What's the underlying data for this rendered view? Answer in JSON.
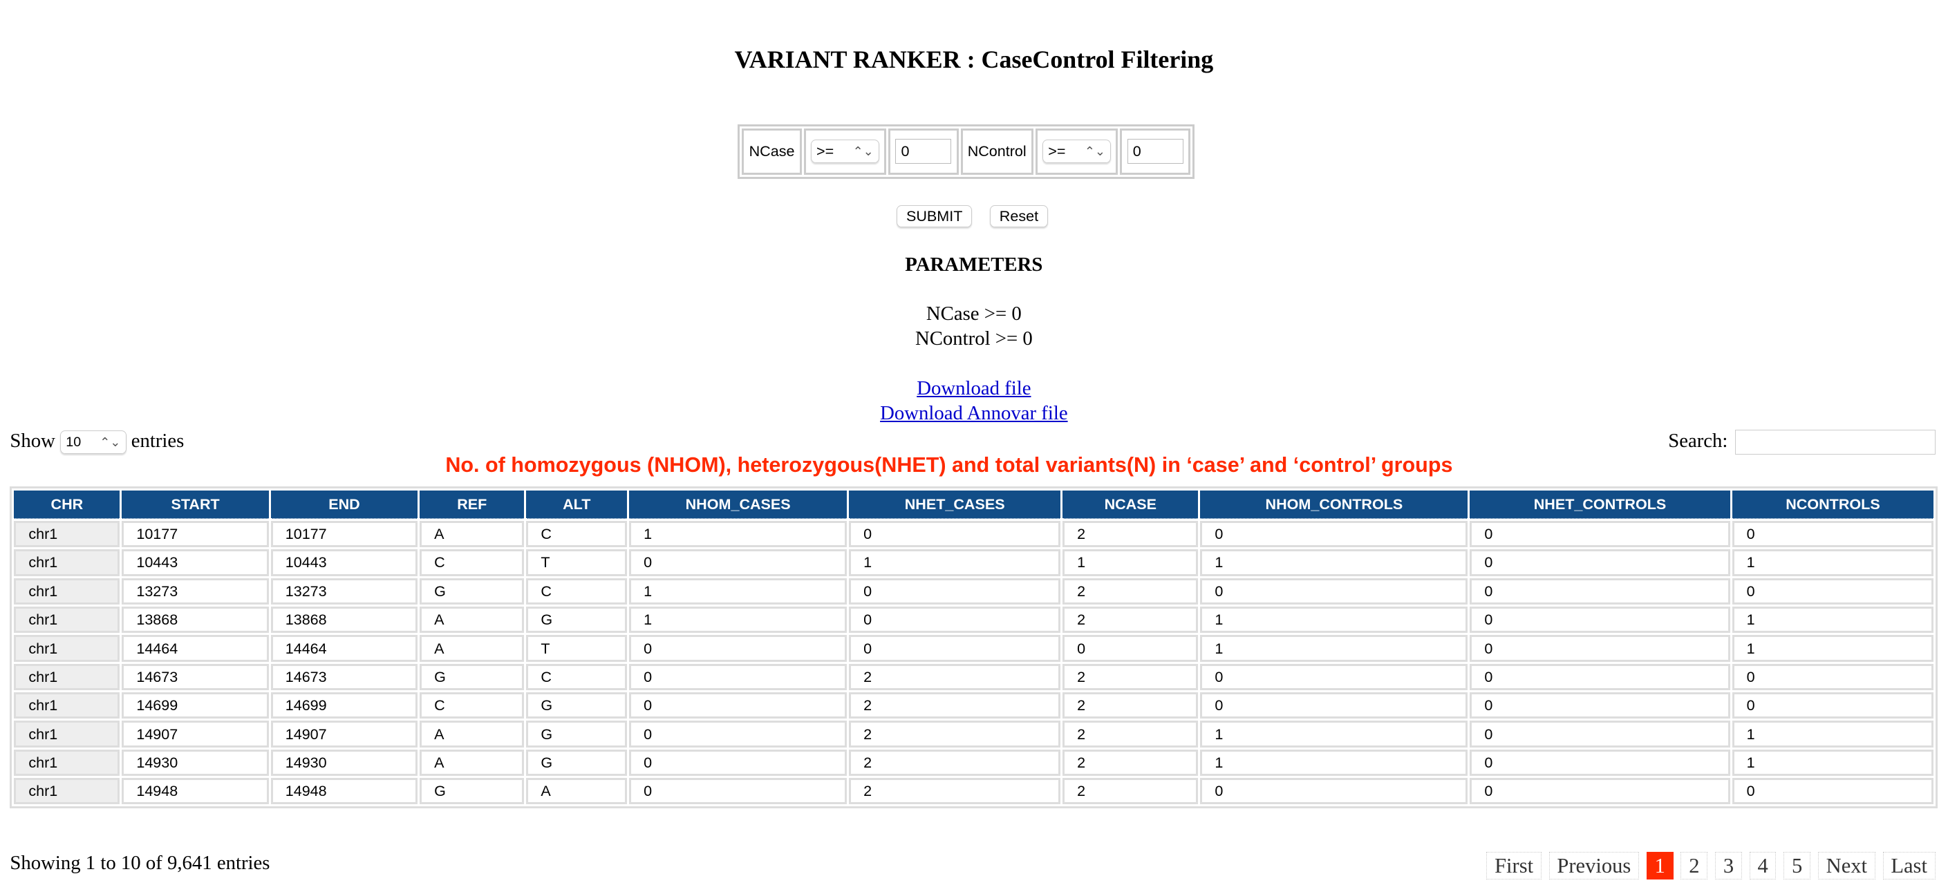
{
  "title": "VARIANT RANKER : CaseControl Filtering",
  "filter": {
    "ncase_label": "NCase",
    "ncase_op": ">=",
    "ncase_value": "0",
    "ncontrol_label": "NControl",
    "ncontrol_op": ">=",
    "ncontrol_value": "0"
  },
  "buttons": {
    "submit": "SUBMIT",
    "reset": "Reset"
  },
  "parameters": {
    "heading": "PARAMETERS",
    "line1": "NCase >= 0",
    "line2": "NControl >= 0"
  },
  "links": {
    "download": "Download file ",
    "annovar": "Download Annovar file"
  },
  "length": {
    "show": "Show",
    "value": "10",
    "entries": "entries"
  },
  "search": {
    "label": "Search:",
    "value": ""
  },
  "caption": "No. of homozygous (NHOM), heterozygous(NHET) and total variants(N) in ‘case’ and ‘control’ groups",
  "columns": [
    "CHR",
    "START",
    "END",
    "REF",
    "ALT",
    "NHOM_CASES",
    "NHET_CASES",
    "NCASE",
    "NHOM_CONTROLS",
    "NHET_CONTROLS",
    "NCONTROLS"
  ],
  "rows": [
    [
      "chr1",
      "10177",
      "10177",
      "A",
      "C",
      "1",
      "0",
      "2",
      "0",
      "0",
      "0"
    ],
    [
      "chr1",
      "10443",
      "10443",
      "C",
      "T",
      "0",
      "1",
      "1",
      "1",
      "0",
      "1"
    ],
    [
      "chr1",
      "13273",
      "13273",
      "G",
      "C",
      "1",
      "0",
      "2",
      "0",
      "0",
      "0"
    ],
    [
      "chr1",
      "13868",
      "13868",
      "A",
      "G",
      "1",
      "0",
      "2",
      "1",
      "0",
      "1"
    ],
    [
      "chr1",
      "14464",
      "14464",
      "A",
      "T",
      "0",
      "0",
      "0",
      "1",
      "0",
      "1"
    ],
    [
      "chr1",
      "14673",
      "14673",
      "G",
      "C",
      "0",
      "2",
      "2",
      "0",
      "0",
      "0"
    ],
    [
      "chr1",
      "14699",
      "14699",
      "C",
      "G",
      "0",
      "2",
      "2",
      "0",
      "0",
      "0"
    ],
    [
      "chr1",
      "14907",
      "14907",
      "A",
      "G",
      "0",
      "2",
      "2",
      "1",
      "0",
      "1"
    ],
    [
      "chr1",
      "14930",
      "14930",
      "A",
      "G",
      "0",
      "2",
      "2",
      "1",
      "0",
      "1"
    ],
    [
      "chr1",
      "14948",
      "14948",
      "G",
      "A",
      "0",
      "2",
      "2",
      "0",
      "0",
      "0"
    ]
  ],
  "status": "Showing 1 to 10 of 9,641 entries",
  "pager": {
    "items": [
      "First",
      "Previous",
      "1",
      "2",
      "3",
      "4",
      "5",
      "Next",
      "Last"
    ],
    "active": "1"
  },
  "colors": {
    "header": "#124d87",
    "accent": "#ff2a00"
  }
}
